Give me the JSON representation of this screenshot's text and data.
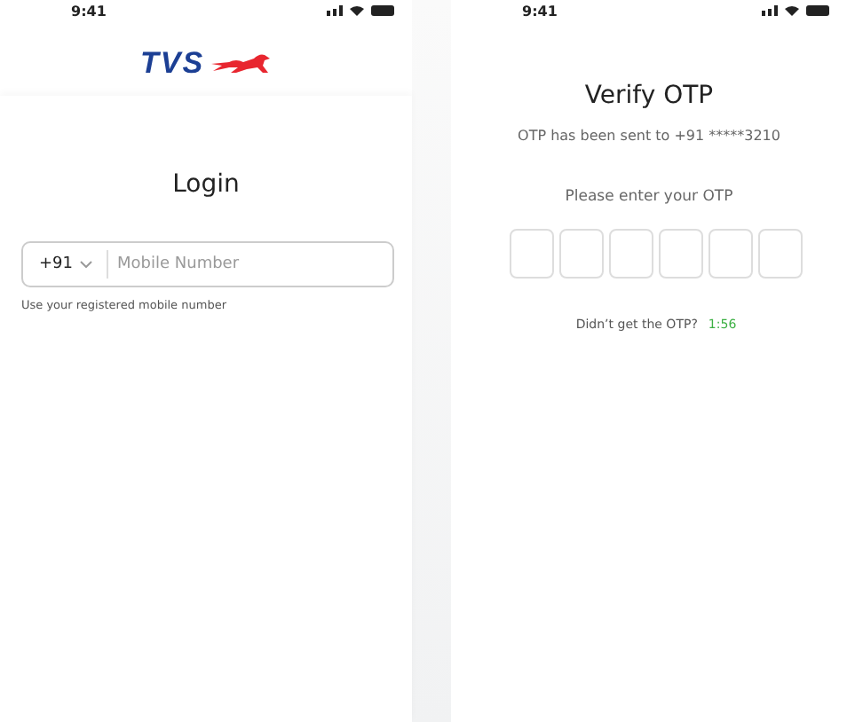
{
  "screens": [
    {
      "kind": "login",
      "status_bar": {
        "time": "9:41"
      },
      "logo": {
        "text": "TVS"
      },
      "title": "Login",
      "phone_field": {
        "country_code": "+91",
        "placeholder": "Mobile Number"
      },
      "hint": "Use your registered mobile number"
    },
    {
      "kind": "otp",
      "status_bar": {
        "time": "9:41"
      },
      "title": "Verify OTP",
      "subtitle": "OTP has been sent to +91 *****3210",
      "prompt": "Please enter your OTP",
      "otp_fields": [
        {
          "filled": false
        },
        {
          "filled": false
        },
        {
          "filled": false
        },
        {
          "filled": false
        },
        {
          "filled": false
        },
        {
          "filled": false
        }
      ],
      "resend_text": "Didn’t get the OTP?",
      "timer": "1:56"
    }
  ]
}
